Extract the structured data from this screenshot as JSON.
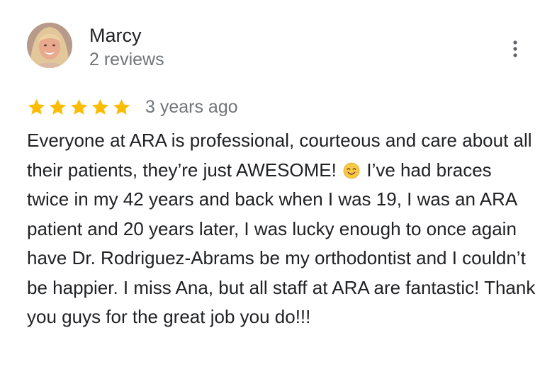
{
  "review": {
    "author_name": "Marcy",
    "review_count": "2 reviews",
    "rating": 5,
    "rating_max": 5,
    "date": "3 years ago",
    "text_part1": "Everyone at ARA is professional, courteous and care about all their patients, they’re just AWESOME!",
    "emoji_icon": "smiling-face-emoji",
    "text_part2": "I’ve had braces twice in my 42 years and back when I was 19, I was an ARA patient and 20 years later, I was lucky enough to once again have Dr. Rodriguez-Abrams be my orthodontist and I couldn’t be happier. I miss Ana, but all staff at ARA are fantastic! Thank you guys for the great job you do!!!"
  },
  "icons": {
    "more": "more-vert-icon",
    "star": "star-icon",
    "avatar": "user-avatar"
  },
  "colors": {
    "star": "#fbbc04",
    "secondary_text": "#70757a",
    "primary_text": "#202124",
    "more_icon": "#5f6368"
  }
}
